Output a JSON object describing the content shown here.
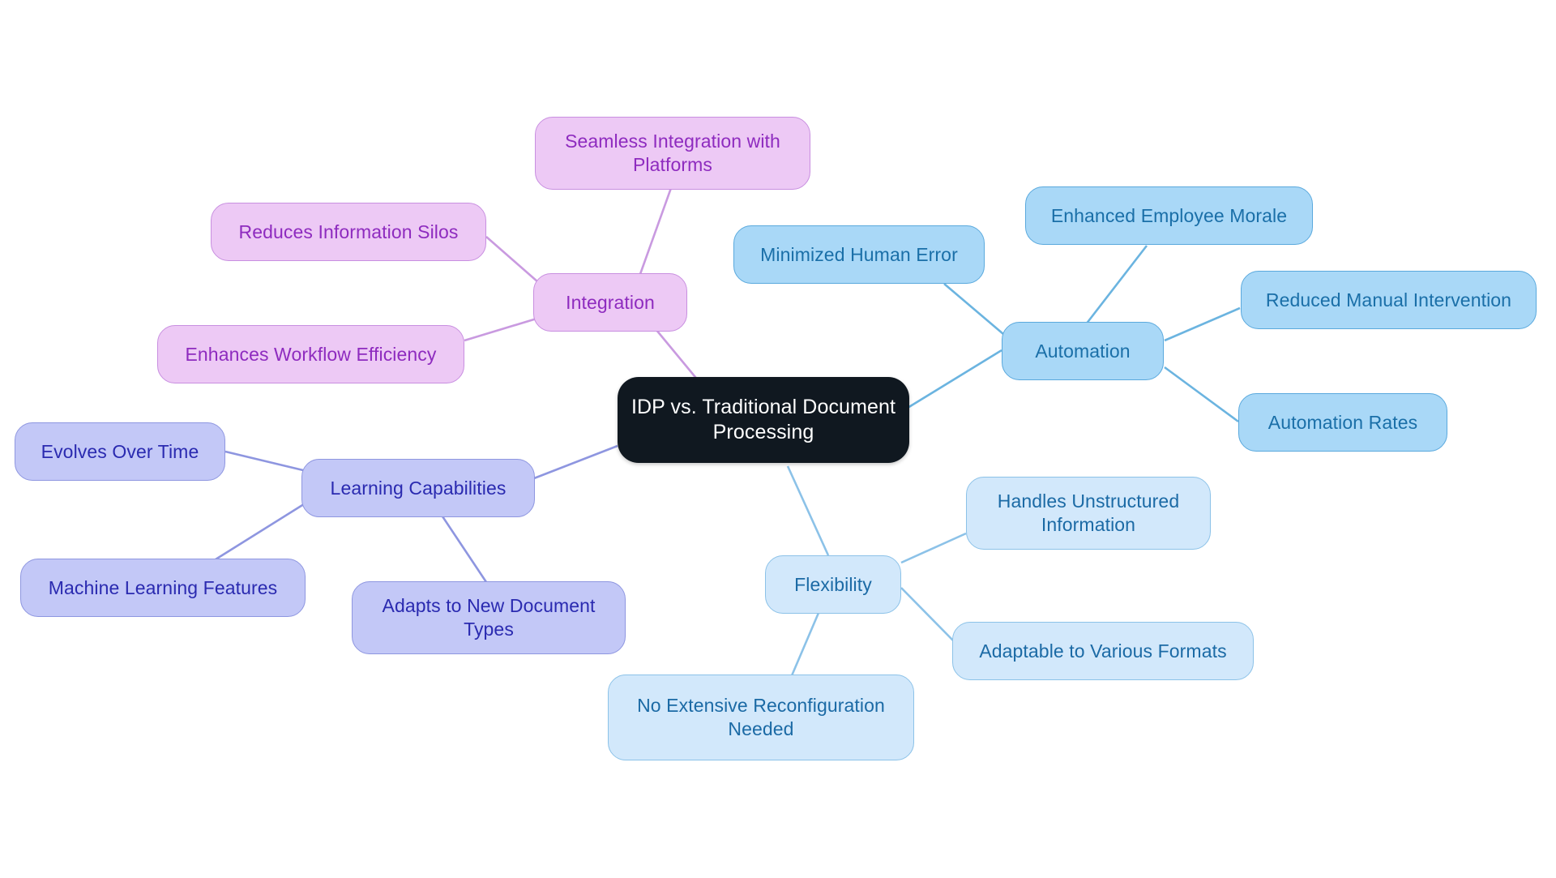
{
  "diagram": {
    "type": "mindmap",
    "title": "IDP vs. Traditional Document Processing",
    "background": "#ffffff",
    "root": {
      "id": "root",
      "label": "IDP vs. Traditional Document\nProcessing",
      "fill": "#101820",
      "text_color": "#ffffff"
    },
    "branches": [
      {
        "id": "automation",
        "label": "Automation",
        "fill": "#a9d8f7",
        "border": "#5aa9dd",
        "text_color": "#1a6fa8",
        "edge_color": "#6bb4e0",
        "children": [
          {
            "id": "enhanced-employee-morale",
            "label": "Enhanced Employee Morale"
          },
          {
            "id": "minimized-human-error",
            "label": "Minimized Human Error"
          },
          {
            "id": "reduced-manual-intervention",
            "label": "Reduced Manual Intervention"
          },
          {
            "id": "automation-rates",
            "label": "Automation Rates"
          }
        ]
      },
      {
        "id": "flexibility",
        "label": "Flexibility",
        "fill": "#d2e8fb",
        "border": "#8cc2e8",
        "text_color": "#1b6aa5",
        "edge_color": "#8cc2e8",
        "children": [
          {
            "id": "handles-unstructured-information",
            "label": "Handles Unstructured\nInformation"
          },
          {
            "id": "adaptable-to-various-formats",
            "label": "Adaptable to Various Formats"
          },
          {
            "id": "no-extensive-reconfiguration-needed",
            "label": "No Extensive Reconfiguration\nNeeded"
          }
        ]
      },
      {
        "id": "integration",
        "label": "Integration",
        "fill": "#edc9f5",
        "border": "#c88fe0",
        "text_color": "#8e2bbf",
        "edge_color": "#c99ae0",
        "children": [
          {
            "id": "seamless-integration-with-platforms",
            "label": "Seamless Integration with\nPlatforms"
          },
          {
            "id": "reduces-information-silos",
            "label": "Reduces Information Silos"
          },
          {
            "id": "enhances-workflow-efficiency",
            "label": "Enhances Workflow Efficiency"
          }
        ]
      },
      {
        "id": "learning-capabilities",
        "label": "Learning Capabilities",
        "fill": "#c3c8f7",
        "border": "#8e96e0",
        "text_color": "#2a2ab0",
        "edge_color": "#8e96e0",
        "children": [
          {
            "id": "evolves-over-time",
            "label": "Evolves Over Time"
          },
          {
            "id": "machine-learning-features",
            "label": "Machine Learning Features"
          },
          {
            "id": "adapts-to-new-document-types",
            "label": "Adapts to New Document\nTypes"
          }
        ]
      }
    ]
  }
}
